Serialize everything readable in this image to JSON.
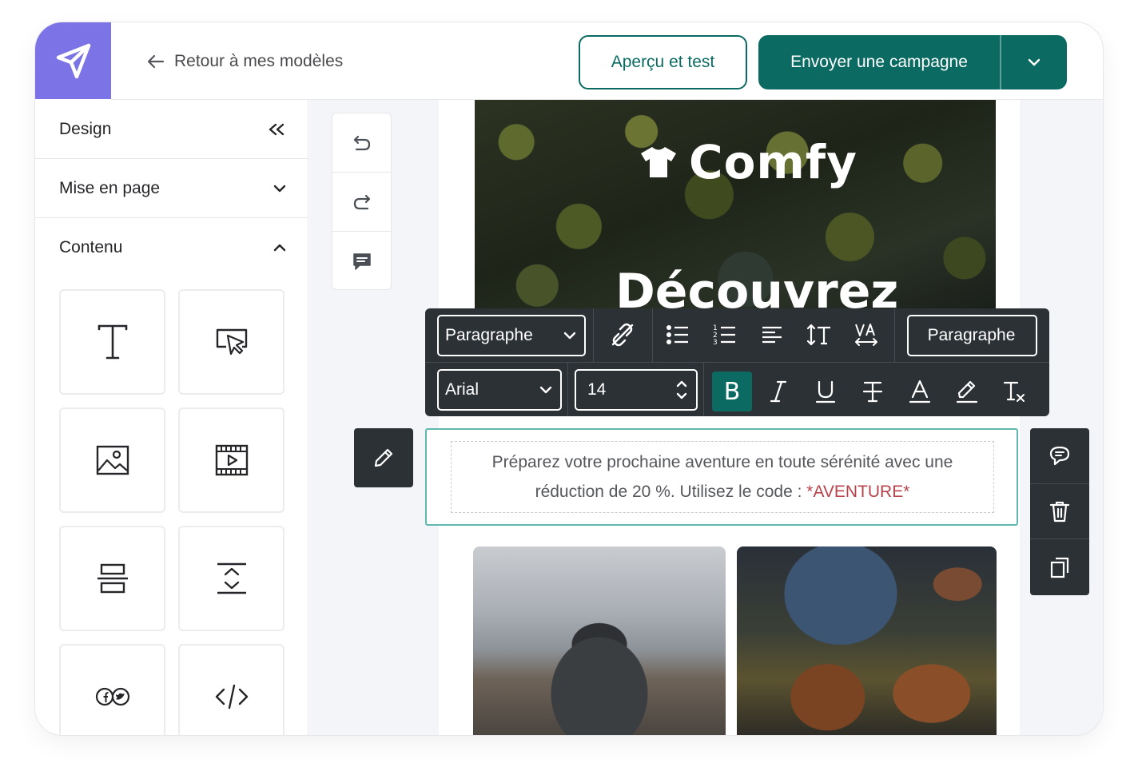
{
  "header": {
    "back_label": "Retour à mes modèles",
    "preview_label": "Aperçu et test",
    "send_label": "Envoyer une campagne"
  },
  "sidebar": {
    "sections": [
      {
        "label": "Design",
        "icon": "collapse-double-chevron-left-icon"
      },
      {
        "label": "Mise en page",
        "icon": "chevron-down-icon"
      },
      {
        "label": "Contenu",
        "icon": "chevron-up-icon"
      }
    ],
    "tiles": [
      "text-block-icon",
      "button-block-icon",
      "image-block-icon",
      "video-block-icon",
      "divider-block-icon",
      "spacer-block-icon",
      "social-block-icon",
      "html-code-block-icon"
    ]
  },
  "hero": {
    "brand": "Comfy",
    "title": "Découvrez"
  },
  "toolbar": {
    "block_type": "Paragraphe",
    "style_label": "Paragraphe",
    "font": "Arial",
    "font_size": "14",
    "bold_letter": "B"
  },
  "content": {
    "text_main": "Préparez votre prochaine aventure en toute sérénité avec une réduction de 20 %. Utilisez le code : ",
    "code": "*AVENTURE*"
  },
  "colors": {
    "accent": "#0b6b63",
    "logo_bg": "#7c74e6",
    "toolbar_bg": "#2c3136",
    "selection_border": "#5fb7ad",
    "code_text": "#b8434a"
  }
}
